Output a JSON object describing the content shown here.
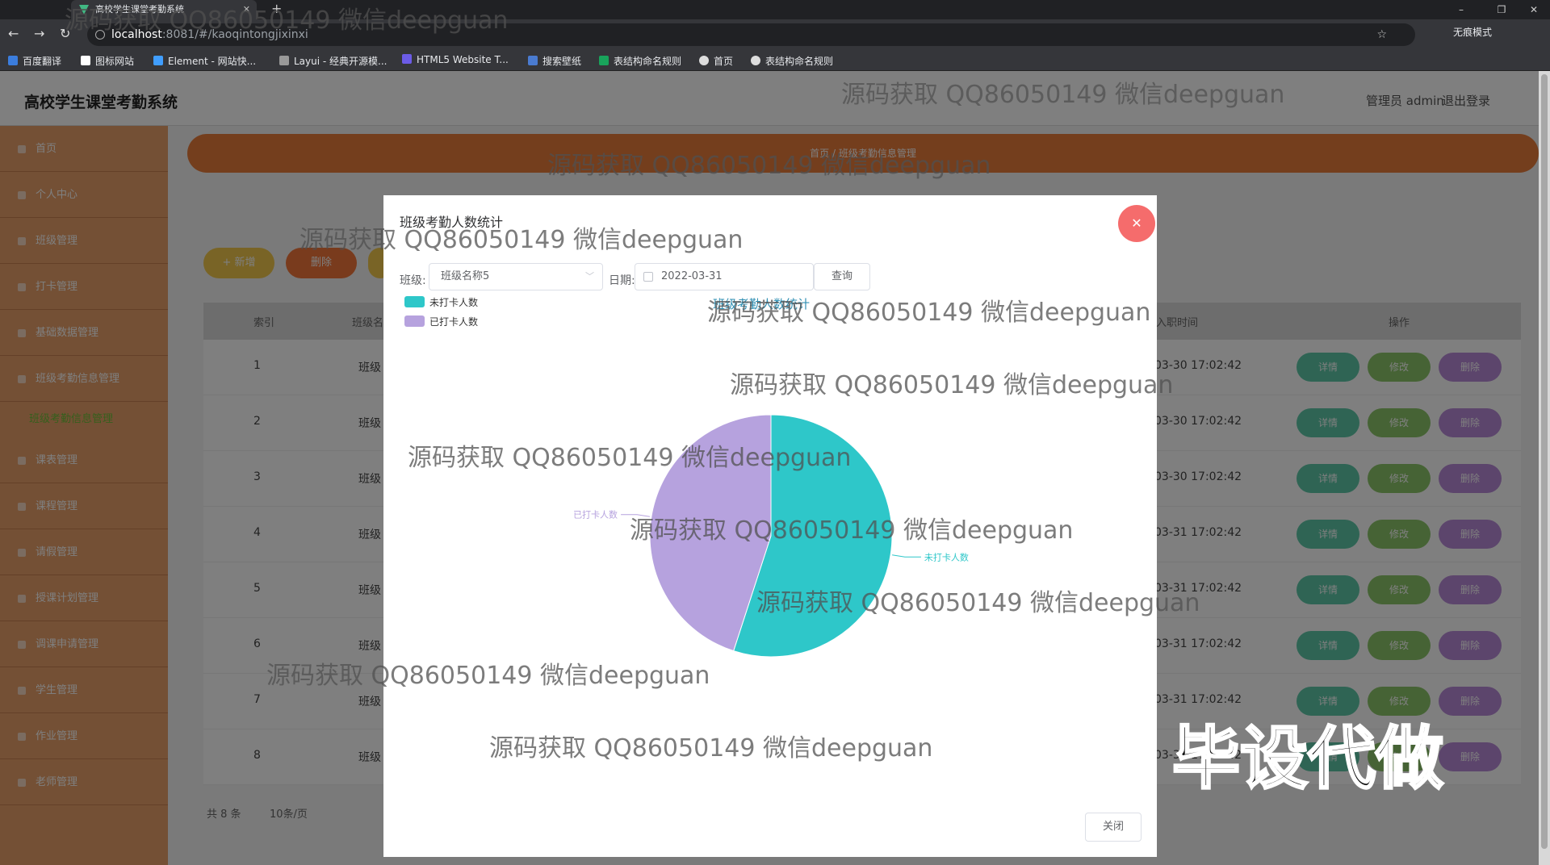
{
  "browser": {
    "tab_title": "高校学生课堂考勤系统",
    "url_host": "localhost",
    "url_path": ":8081/#/kaoqintongjixinxi",
    "incognito_label": "无痕模式",
    "bookmarks": [
      {
        "label": "百度翻译",
        "color": "#3b7ddd"
      },
      {
        "label": "图标网站",
        "color": "#ffffff"
      },
      {
        "label": "Element - 网站快...",
        "color": "#409eff"
      },
      {
        "label": "Layui - 经典开源模...",
        "color": "#999999"
      },
      {
        "label": "HTML5 Website T...",
        "color": "#6c5ce7"
      },
      {
        "label": "搜索壁纸",
        "color": "#4a7bd0"
      },
      {
        "label": "表结构命名规则",
        "color": "#19a35b"
      },
      {
        "label": "首页",
        "color": "#dddddd"
      },
      {
        "label": "表结构命名规则",
        "color": "#dddddd"
      }
    ]
  },
  "header": {
    "app_title": "高校学生课堂考勤系统",
    "admin_label": "管理员 admin",
    "logout_label": "退出登录"
  },
  "breadcrumb": "首页 / 班级考勤信息管理",
  "sidebar": {
    "items": [
      "首页",
      "个人中心",
      "班级管理",
      "打卡管理",
      "基础数据管理",
      "班级考勤信息管理"
    ],
    "active_sub": "班级考勤信息管理",
    "items_after": [
      "课表管理",
      "课程管理",
      "请假管理",
      "授课计划管理",
      "调课申请管理",
      "学生管理",
      "作业管理",
      "老师管理"
    ]
  },
  "toolbar": {
    "add_label": "+ 新增",
    "delete_label": "删除"
  },
  "table": {
    "headers": [
      "索引",
      "班级名称",
      "入职时间",
      "操作"
    ],
    "rows": [
      {
        "index": "1",
        "class": "班级",
        "time": "03-30 17:02:42"
      },
      {
        "index": "2",
        "class": "班级",
        "time": "03-30 17:02:42"
      },
      {
        "index": "3",
        "class": "班级",
        "time": "03-30 17:02:42"
      },
      {
        "index": "4",
        "class": "班级",
        "time": "03-31 17:02:42"
      },
      {
        "index": "5",
        "class": "班级",
        "time": "03-31 17:02:42"
      },
      {
        "index": "6",
        "class": "班级",
        "time": "03-31 17:02:42"
      },
      {
        "index": "7",
        "class": "班级",
        "time": "03-31 17:02:42"
      },
      {
        "index": "8",
        "class": "班级",
        "time": "03-31 17:02:42"
      }
    ],
    "op_detail": "详情",
    "op_edit": "修改",
    "op_delete": "删除"
  },
  "pager": {
    "total": "共 8 条",
    "per_page": "10条/页"
  },
  "dialog": {
    "title": "班级考勤人数统计",
    "class_label": "班级:",
    "class_value": "班级名称5",
    "date_label": "日期:",
    "date_value": "2022-03-31",
    "query_label": "查询",
    "chart_title": "班级考勤人数统计",
    "close_label": "关闭"
  },
  "chart_data": {
    "type": "pie",
    "title": "班级考勤人数统计",
    "legend": [
      "未打卡人数",
      "已打卡人数"
    ],
    "slices": [
      {
        "label": "未打卡人数",
        "value": 55,
        "color": "#2ec7c9"
      },
      {
        "label": "已打卡人数",
        "value": 45,
        "color": "#b6a2de"
      }
    ]
  },
  "watermark": {
    "text": "源码获取 QQ86050149 微信deepguan",
    "big": "毕设代做"
  }
}
